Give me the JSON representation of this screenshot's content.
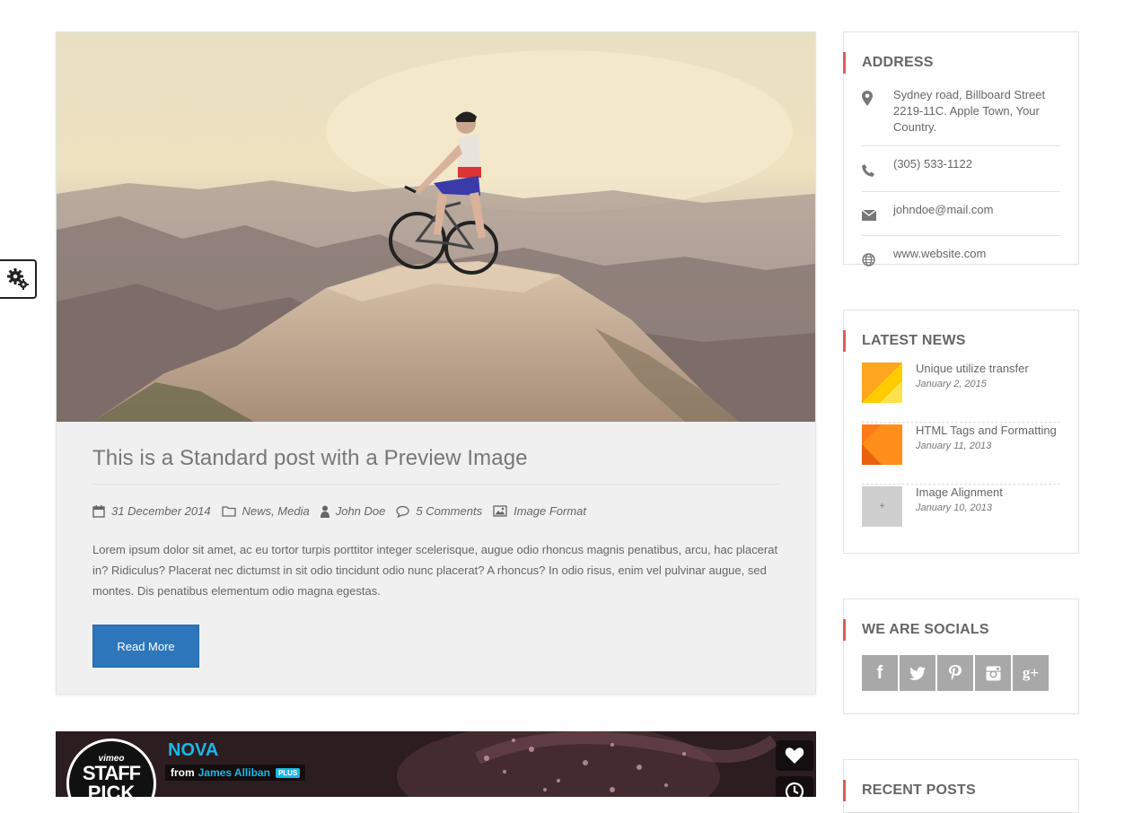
{
  "post": {
    "title": "This is a Standard post with a Preview Image",
    "date": "31 December 2014",
    "categories": "News, Media",
    "author": "John Doe",
    "comments": "5 Comments",
    "format": "Image Format",
    "excerpt": "Lorem ipsum dolor sit amet, ac eu tortor turpis porttitor integer scelerisque, augue odio rhoncus magnis penatibus, arcu, hac placerat in? Ridiculus? Placerat nec dictumst in sit odio tincidunt odio nunc placerat? A rhoncus? In odio risus, enim vel pulvinar augue, sed montes. Dis penatibus elementum odio magna egestas.",
    "read_more": "Read More"
  },
  "video": {
    "title": "NOVA",
    "from_label": "from",
    "author": "James Alliban",
    "badge": "PLUS",
    "staff_pick_vimeo": "vimeo",
    "staff_pick_staff": "STAFF",
    "staff_pick_pick": "PICK"
  },
  "sidebar": {
    "address": {
      "title": "ADDRESS",
      "location": "Sydney road, Billboard Street 2219-11C. Apple Town, Your Country.",
      "phone": "(305) 533-1122",
      "email": "johndoe@mail.com",
      "website": "www.website.com"
    },
    "latest_news": {
      "title": "LATEST NEWS",
      "items": [
        {
          "title": "Unique utilize transfer",
          "date": "January 2, 2015"
        },
        {
          "title": "HTML Tags and Formatting",
          "date": "January 11, 2013"
        },
        {
          "title": "Image Alignment",
          "date": "January 10, 2013"
        }
      ],
      "placeholder_glyph": "+"
    },
    "socials": {
      "title": "WE ARE SOCIALS",
      "icons": [
        "facebook-icon",
        "twitter-icon",
        "pinterest-icon",
        "instagram-icon",
        "google-plus-icon"
      ],
      "labels": {
        "facebook": "f",
        "google_plus": "g+"
      }
    },
    "recent_posts": {
      "title": "RECENT POSTS"
    }
  },
  "colors": {
    "accent_blue": "#2e76bb",
    "widget_accent": "#e35b5b",
    "vimeo_blue": "#1ab7ea",
    "social_gray": "#a8a8a8"
  }
}
